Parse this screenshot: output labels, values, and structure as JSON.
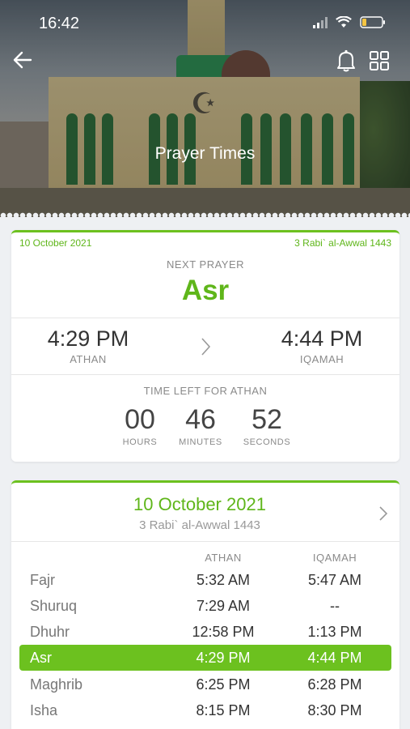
{
  "status_bar": {
    "time": "16:42"
  },
  "header": {
    "title": "Prayer Times"
  },
  "next_prayer_card": {
    "gregorian_date": "10 October 2021",
    "hijri_date": "3 Rabi` al-Awwal 1443",
    "label": "NEXT PRAYER",
    "prayer": "Asr",
    "athan_time": "4:29 PM",
    "athan_label": "ATHAN",
    "iqamah_time": "4:44 PM",
    "iqamah_label": "IQAMAH",
    "countdown_label": "TIME LEFT FOR ATHAN",
    "countdown": {
      "hours": "00",
      "hours_label": "HOURS",
      "minutes": "46",
      "minutes_label": "MINUTES",
      "seconds": "52",
      "seconds_label": "SECONDS"
    }
  },
  "schedule_card": {
    "gregorian_date": "10 October 2021",
    "hijri_date": "3 Rabi` al-Awwal 1443",
    "columns": [
      "ATHAN",
      "IQAMAH"
    ],
    "rows": [
      {
        "name": "Fajr",
        "athan": "5:32 AM",
        "iqamah": "5:47 AM"
      },
      {
        "name": "Shuruq",
        "athan": "7:29 AM",
        "iqamah": "--"
      },
      {
        "name": "Dhuhr",
        "athan": "12:58 PM",
        "iqamah": "1:13 PM"
      },
      {
        "name": "Asr",
        "athan": "4:29 PM",
        "iqamah": "4:44 PM"
      },
      {
        "name": "Maghrib",
        "athan": "6:25 PM",
        "iqamah": "6:28 PM"
      },
      {
        "name": "Isha",
        "athan": "8:15 PM",
        "iqamah": "8:30 PM"
      }
    ],
    "active_row": "Asr"
  },
  "colors": {
    "accent": "#6cc11f",
    "accent_text": "#5fb61a"
  },
  "icons": [
    "back-arrow-icon",
    "bell-icon",
    "grid-icon",
    "chevron-right-icon",
    "signal-icon",
    "wifi-icon",
    "battery-icon"
  ]
}
